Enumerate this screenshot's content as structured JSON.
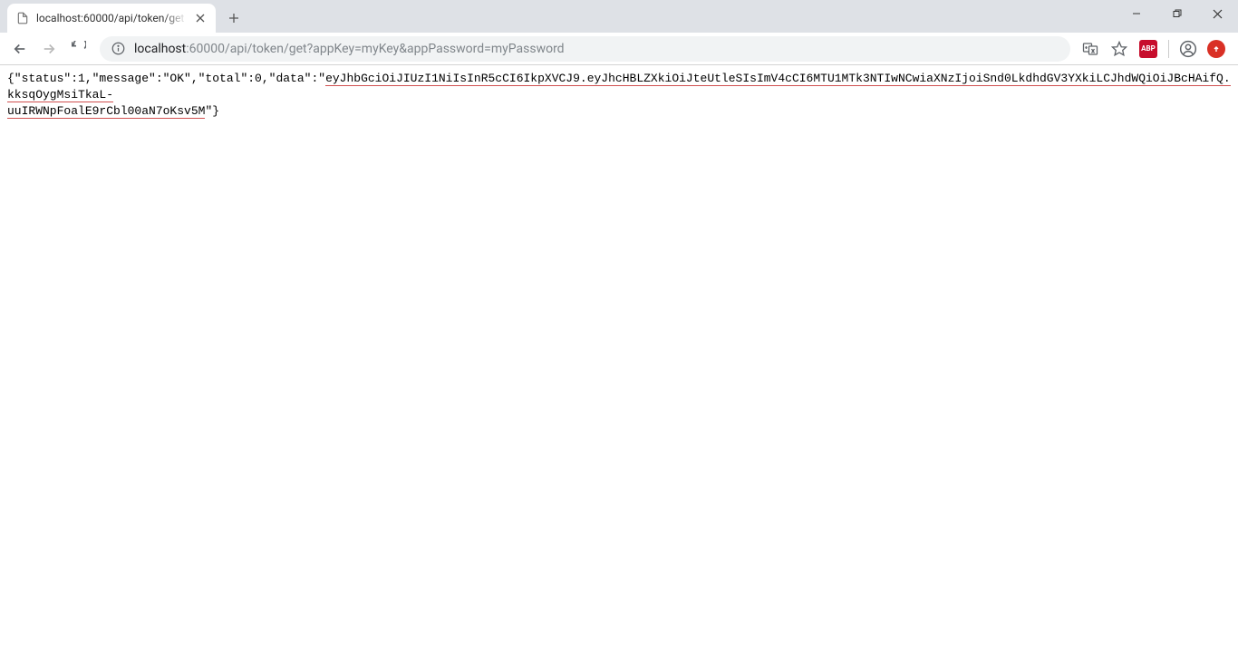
{
  "tab": {
    "title": "localhost:60000/api/token/get"
  },
  "url": {
    "host": "localhost",
    "path": ":60000/api/token/get?appKey=myKey&appPassword=myPassword"
  },
  "extensions": {
    "abp_label": "ABP"
  },
  "page": {
    "json_prefix": "{\"status\":1,\"message\":\"OK\",\"total\":0,\"data\":\"",
    "token_part1": "eyJhbGciOiJIUzI1NiIsInR5cCI6IkpXVCJ9.eyJhcHBLZXkiOiJteUtleSIsImV4cCI6MTU1MTk3NTIwNCwiaXNzIjoiSnd0LkdhdGV3YXkiLCJhdWQiOiJBcHAifQ.kksqOygMsiTkaL-",
    "token_part2": "uuIRWNpFoalE9rCbl00aN7oKsv5M",
    "json_suffix": "\"}"
  }
}
